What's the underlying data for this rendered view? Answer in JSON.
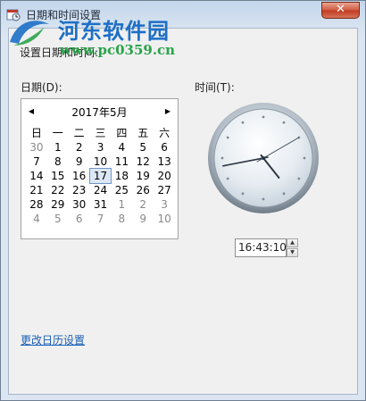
{
  "window": {
    "title": "日期和时间设置",
    "close_label": "✕"
  },
  "watermark": {
    "site_name": "河东软件园",
    "url": "www.pc0359.cn"
  },
  "main": {
    "instruction": "设置日期和时间:",
    "date_label": "日期(D):",
    "time_label": "时间(T):",
    "change_calendar_link": "更改日历设置"
  },
  "calendar": {
    "title": "2017年5月",
    "prev_icon": "◀",
    "next_icon": "▶",
    "weekdays": [
      "日",
      "一",
      "二",
      "三",
      "四",
      "五",
      "六"
    ],
    "weeks": [
      [
        "30",
        "1",
        "2",
        "3",
        "4",
        "5",
        "6"
      ],
      [
        "7",
        "8",
        "9",
        "10",
        "11",
        "12",
        "13"
      ],
      [
        "14",
        "15",
        "16",
        "17",
        "18",
        "19",
        "20"
      ],
      [
        "21",
        "22",
        "23",
        "24",
        "25",
        "26",
        "27"
      ],
      [
        "28",
        "29",
        "30",
        "31",
        "1",
        "2",
        "3"
      ],
      [
        "4",
        "5",
        "6",
        "7",
        "8",
        "9",
        "10"
      ]
    ],
    "selected_day": "17"
  },
  "clock": {
    "hour": 16,
    "minute": 43,
    "second": 10
  },
  "time": {
    "value": "16:43:10",
    "spin_up": "▲",
    "spin_down": "▼"
  },
  "colors": {
    "link": "#1a5fb4",
    "watermark_name": "#1d6fc6",
    "watermark_url": "#2aa34a"
  }
}
